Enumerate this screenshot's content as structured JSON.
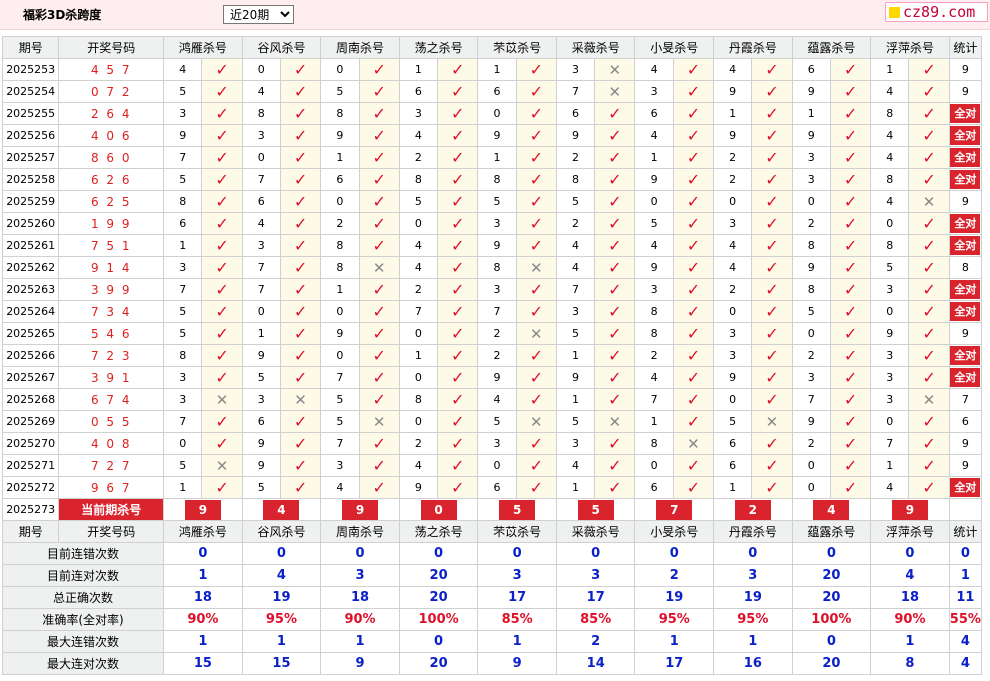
{
  "page": {
    "title": "福彩3D杀跨度",
    "range_selected": "近20期",
    "logo_text": "cz89.com"
  },
  "headers": {
    "period": "期号",
    "numbers": "开奖号码",
    "experts": [
      "鸿雁杀号",
      "谷风杀号",
      "周南杀号",
      "荡之杀号",
      "芣苡杀号",
      "采薇杀号",
      "小旻杀号",
      "丹霞杀号",
      "蕴露杀号",
      "浮萍杀号"
    ],
    "stat": "统计"
  },
  "all_correct_label": "全对",
  "rows": [
    {
      "period": "2025253",
      "draw": "4 5 7",
      "kills": [
        "4",
        "0",
        "0",
        "1",
        "1",
        "3",
        "4",
        "4",
        "6",
        "1"
      ],
      "ok": [
        1,
        1,
        1,
        1,
        1,
        0,
        1,
        1,
        1,
        1
      ],
      "stat": "9"
    },
    {
      "period": "2025254",
      "draw": "0 7 2",
      "kills": [
        "5",
        "4",
        "5",
        "6",
        "6",
        "7",
        "3",
        "9",
        "9",
        "4"
      ],
      "ok": [
        1,
        1,
        1,
        1,
        1,
        0,
        1,
        1,
        1,
        1
      ],
      "stat": "9"
    },
    {
      "period": "2025255",
      "draw": "2 6 4",
      "kills": [
        "3",
        "8",
        "8",
        "3",
        "0",
        "6",
        "6",
        "1",
        "1",
        "8"
      ],
      "ok": [
        1,
        1,
        1,
        1,
        1,
        1,
        1,
        1,
        1,
        1
      ],
      "stat": "全对"
    },
    {
      "period": "2025256",
      "draw": "4 0 6",
      "kills": [
        "9",
        "3",
        "9",
        "4",
        "9",
        "9",
        "4",
        "9",
        "9",
        "4"
      ],
      "ok": [
        1,
        1,
        1,
        1,
        1,
        1,
        1,
        1,
        1,
        1
      ],
      "stat": "全对"
    },
    {
      "period": "2025257",
      "draw": "8 6 0",
      "kills": [
        "7",
        "0",
        "1",
        "2",
        "1",
        "2",
        "1",
        "2",
        "3",
        "4"
      ],
      "ok": [
        1,
        1,
        1,
        1,
        1,
        1,
        1,
        1,
        1,
        1
      ],
      "stat": "全对"
    },
    {
      "period": "2025258",
      "draw": "6 2 6",
      "kills": [
        "5",
        "7",
        "6",
        "8",
        "8",
        "8",
        "9",
        "2",
        "3",
        "8"
      ],
      "ok": [
        1,
        1,
        1,
        1,
        1,
        1,
        1,
        1,
        1,
        1
      ],
      "stat": "全对"
    },
    {
      "period": "2025259",
      "draw": "6 2 5",
      "kills": [
        "8",
        "6",
        "0",
        "5",
        "5",
        "5",
        "0",
        "0",
        "0",
        "4"
      ],
      "ok": [
        1,
        1,
        1,
        1,
        1,
        1,
        1,
        1,
        1,
        0
      ],
      "stat": "9"
    },
    {
      "period": "2025260",
      "draw": "1 9 9",
      "kills": [
        "6",
        "4",
        "2",
        "0",
        "3",
        "2",
        "5",
        "3",
        "2",
        "0"
      ],
      "ok": [
        1,
        1,
        1,
        1,
        1,
        1,
        1,
        1,
        1,
        1
      ],
      "stat": "全对"
    },
    {
      "period": "2025261",
      "draw": "7 5 1",
      "kills": [
        "1",
        "3",
        "8",
        "4",
        "9",
        "4",
        "4",
        "4",
        "8",
        "8"
      ],
      "ok": [
        1,
        1,
        1,
        1,
        1,
        1,
        1,
        1,
        1,
        1
      ],
      "stat": "全对"
    },
    {
      "period": "2025262",
      "draw": "9 1 4",
      "kills": [
        "3",
        "7",
        "8",
        "4",
        "8",
        "4",
        "9",
        "4",
        "9",
        "5"
      ],
      "ok": [
        1,
        1,
        0,
        1,
        0,
        1,
        1,
        1,
        1,
        1
      ],
      "stat": "8"
    },
    {
      "period": "2025263",
      "draw": "3 9 9",
      "kills": [
        "7",
        "7",
        "1",
        "2",
        "3",
        "7",
        "3",
        "2",
        "8",
        "3"
      ],
      "ok": [
        1,
        1,
        1,
        1,
        1,
        1,
        1,
        1,
        1,
        1
      ],
      "stat": "全对"
    },
    {
      "period": "2025264",
      "draw": "7 3 4",
      "kills": [
        "5",
        "0",
        "0",
        "7",
        "7",
        "3",
        "8",
        "0",
        "5",
        "0"
      ],
      "ok": [
        1,
        1,
        1,
        1,
        1,
        1,
        1,
        1,
        1,
        1
      ],
      "stat": "全对"
    },
    {
      "period": "2025265",
      "draw": "5 4 6",
      "kills": [
        "5",
        "1",
        "9",
        "0",
        "2",
        "5",
        "8",
        "3",
        "0",
        "9"
      ],
      "ok": [
        1,
        1,
        1,
        1,
        0,
        1,
        1,
        1,
        1,
        1
      ],
      "stat": "9"
    },
    {
      "period": "2025266",
      "draw": "7 2 3",
      "kills": [
        "8",
        "9",
        "0",
        "1",
        "2",
        "1",
        "2",
        "3",
        "2",
        "3"
      ],
      "ok": [
        1,
        1,
        1,
        1,
        1,
        1,
        1,
        1,
        1,
        1
      ],
      "stat": "全对"
    },
    {
      "period": "2025267",
      "draw": "3 9 1",
      "kills": [
        "3",
        "5",
        "7",
        "0",
        "9",
        "9",
        "4",
        "9",
        "3",
        "3"
      ],
      "ok": [
        1,
        1,
        1,
        1,
        1,
        1,
        1,
        1,
        1,
        1
      ],
      "stat": "全对"
    },
    {
      "period": "2025268",
      "draw": "6 7 4",
      "kills": [
        "3",
        "3",
        "5",
        "8",
        "4",
        "1",
        "7",
        "0",
        "7",
        "3"
      ],
      "ok": [
        0,
        0,
        1,
        1,
        1,
        1,
        1,
        1,
        1,
        0
      ],
      "stat": "7"
    },
    {
      "period": "2025269",
      "draw": "0 5 5",
      "kills": [
        "7",
        "6",
        "5",
        "0",
        "5",
        "5",
        "1",
        "5",
        "9",
        "0"
      ],
      "ok": [
        1,
        1,
        0,
        1,
        0,
        0,
        1,
        0,
        1,
        1
      ],
      "stat": "6"
    },
    {
      "period": "2025270",
      "draw": "4 0 8",
      "kills": [
        "0",
        "9",
        "7",
        "2",
        "3",
        "3",
        "8",
        "6",
        "2",
        "7"
      ],
      "ok": [
        1,
        1,
        1,
        1,
        1,
        1,
        0,
        1,
        1,
        1
      ],
      "stat": "9"
    },
    {
      "period": "2025271",
      "draw": "7 2 7",
      "kills": [
        "5",
        "9",
        "3",
        "4",
        "0",
        "4",
        "0",
        "6",
        "0",
        "1"
      ],
      "ok": [
        0,
        1,
        1,
        1,
        1,
        1,
        1,
        1,
        1,
        1
      ],
      "stat": "9"
    },
    {
      "period": "2025272",
      "draw": "9 6 7",
      "kills": [
        "1",
        "5",
        "4",
        "9",
        "6",
        "1",
        "6",
        "1",
        "0",
        "4"
      ],
      "ok": [
        1,
        1,
        1,
        1,
        1,
        1,
        1,
        1,
        1,
        1
      ],
      "stat": "全对"
    }
  ],
  "current": {
    "period": "2025273",
    "label": "当前期杀号",
    "kills": [
      "9",
      "4",
      "9",
      "0",
      "5",
      "5",
      "7",
      "2",
      "4",
      "9"
    ]
  },
  "summary": [
    {
      "label": "目前连错次数",
      "values": [
        "0",
        "0",
        "0",
        "0",
        "0",
        "0",
        "0",
        "0",
        "0",
        "0"
      ],
      "stat": "0",
      "type": "count"
    },
    {
      "label": "目前连对次数",
      "values": [
        "1",
        "4",
        "3",
        "20",
        "3",
        "3",
        "2",
        "3",
        "20",
        "4"
      ],
      "stat": "1",
      "type": "count"
    },
    {
      "label": "总正确次数",
      "values": [
        "18",
        "19",
        "18",
        "20",
        "17",
        "17",
        "19",
        "19",
        "20",
        "18"
      ],
      "stat": "11",
      "type": "count"
    },
    {
      "label": "准确率(全对率)",
      "values": [
        "90%",
        "95%",
        "90%",
        "100%",
        "85%",
        "85%",
        "95%",
        "95%",
        "100%",
        "90%"
      ],
      "stat": "55%",
      "type": "pct"
    },
    {
      "label": "最大连错次数",
      "values": [
        "1",
        "1",
        "1",
        "0",
        "1",
        "2",
        "1",
        "1",
        "0",
        "1"
      ],
      "stat": "4",
      "type": "count"
    },
    {
      "label": "最大连对次数",
      "values": [
        "15",
        "15",
        "9",
        "20",
        "9",
        "14",
        "17",
        "16",
        "20",
        "8"
      ],
      "stat": "4",
      "type": "count"
    }
  ],
  "icons": {
    "correct": "check-icon",
    "wrong": "cross-icon"
  },
  "colors": {
    "accent": "#d9232d",
    "header_bg": "#eef1ef",
    "topbar_bg": "#ffeef0",
    "mark_bg": "#fdfbe8",
    "count_blue": "#0b20c8"
  }
}
